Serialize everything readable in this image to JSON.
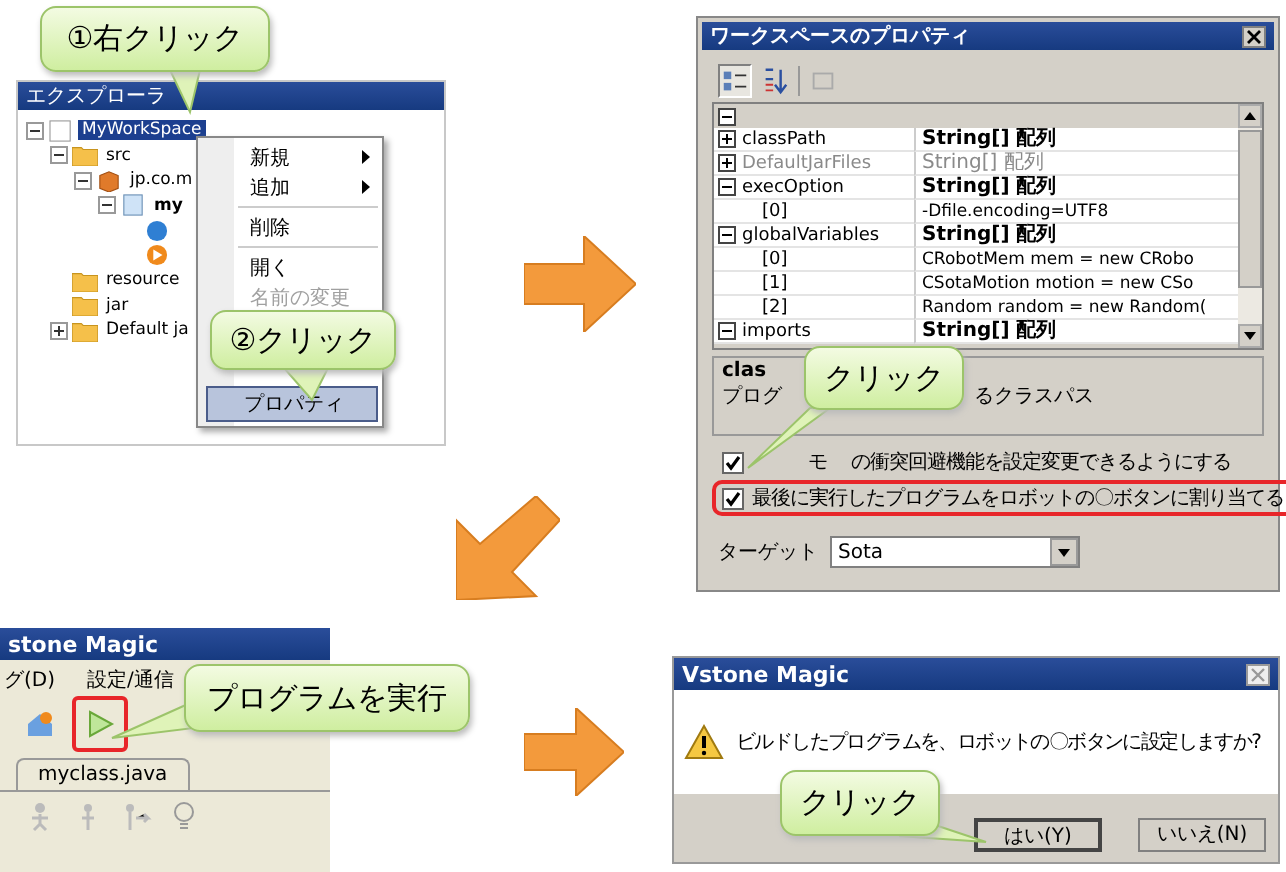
{
  "explorer": {
    "title": "エクスプローラ",
    "tree": [
      {
        "label": "MyWorkSpace",
        "kind": "workspace",
        "selected": true,
        "expanded": true,
        "children": [
          {
            "label": "src",
            "kind": "folder",
            "selected": false,
            "expanded": true,
            "children": [
              {
                "label": "jp.co.m",
                "kind": "package",
                "selected": false,
                "expanded": true,
                "children": [
                  {
                    "label": "my",
                    "kind": "file",
                    "selected": false,
                    "expanded": true,
                    "children": [
                      {
                        "kind": "component"
                      },
                      {
                        "kind": "play"
                      }
                    ]
                  }
                ]
              }
            ]
          },
          {
            "label": "resource",
            "kind": "folder",
            "selected": false
          },
          {
            "label": "jar",
            "kind": "folder",
            "selected": false
          },
          {
            "label": "Default ja",
            "kind": "folder",
            "selected": false,
            "expanded": false
          }
        ]
      }
    ],
    "context_menu": [
      {
        "kind": "item",
        "label": "新規",
        "submenu": true,
        "disabled": false,
        "selected": false
      },
      {
        "kind": "item",
        "label": "追加",
        "submenu": true,
        "disabled": false,
        "selected": false
      },
      {
        "kind": "separator"
      },
      {
        "kind": "item",
        "label": "削除",
        "submenu": false,
        "disabled": false,
        "selected": false
      },
      {
        "kind": "separator"
      },
      {
        "kind": "item",
        "label": "開く",
        "submenu": false,
        "disabled": false,
        "selected": false
      },
      {
        "kind": "item",
        "label": "名前の変更",
        "submenu": false,
        "disabled": true,
        "selected": false
      },
      {
        "kind": "spacer"
      },
      {
        "kind": "item",
        "label": "プロパティ",
        "submenu": false,
        "disabled": false,
        "selected": true
      }
    ],
    "callouts": [
      "①右クリック",
      "②クリック"
    ]
  },
  "properties_dialog": {
    "title": "ワークスペースのプロパティ",
    "rows": [
      {
        "kind": "group",
        "name": "classPath",
        "value": "String[] 配列",
        "expanded": false,
        "disabled": false
      },
      {
        "kind": "group",
        "name": "DefaultJarFiles",
        "value": "String[] 配列",
        "expanded": false,
        "disabled": true
      },
      {
        "kind": "group",
        "name": "execOption",
        "value": "String[] 配列",
        "expanded": true,
        "disabled": false
      },
      {
        "kind": "item",
        "name": "[0]",
        "value": "-Dfile.encoding=UTF8"
      },
      {
        "kind": "group",
        "name": "globalVariables",
        "value": "String[] 配列",
        "expanded": true,
        "disabled": false
      },
      {
        "kind": "item",
        "name": "[0]",
        "value": "CRobotMem mem = new CRobo"
      },
      {
        "kind": "item",
        "name": "[1]",
        "value": "CSotaMotion motion = new CSo"
      },
      {
        "kind": "item",
        "name": "[2]",
        "value": "Random random = new Random("
      },
      {
        "kind": "group",
        "name": "imports",
        "value": "String[] 配列",
        "expanded": true,
        "disabled": false
      }
    ],
    "description": {
      "title": "clas",
      "text_start": "プログ",
      "text_end": "るクラスパス"
    },
    "checkboxes": [
      {
        "label": "モ",
        "label_continued": "の衝突回避機能を設定変更できるようにする",
        "checked": true,
        "highlighted": false
      },
      {
        "label": "最後に実行したプログラムをロボットの〇ボタンに割り当てる",
        "checked": true,
        "highlighted": true
      }
    ],
    "target": {
      "label": "ターゲット",
      "value": "Sota"
    },
    "callout": "クリック"
  },
  "main_window": {
    "title": "stone Magic",
    "menus": [
      "グ(D)",
      "設定/通信"
    ],
    "tab": "myclass.java",
    "callout": "プログラムを実行"
  },
  "confirm_dialog": {
    "title": "Vstone Magic",
    "message": "ビルドしたプログラムを、ロボットの〇ボタンに設定しますか?",
    "buttons": [
      {
        "label": "はい(Y)",
        "default": true
      },
      {
        "label": "いいえ(N)",
        "default": false
      }
    ],
    "callout": "クリック"
  }
}
